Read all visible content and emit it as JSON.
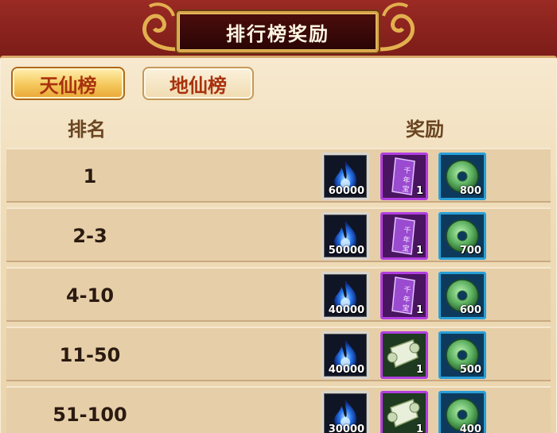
{
  "title": "排行榜奖励",
  "tabs": [
    {
      "label": "天仙榜",
      "active": true
    },
    {
      "label": "地仙榜",
      "active": false
    }
  ],
  "columns": {
    "rank": "排名",
    "reward": "奖励"
  },
  "rows": [
    {
      "rank": "1",
      "rewards": [
        {
          "icon": "blue-flame-icon",
          "count": "60000"
        },
        {
          "icon": "purple-talisman-icon",
          "count": "1"
        },
        {
          "icon": "jade-disc-icon",
          "count": "800"
        }
      ]
    },
    {
      "rank": "2-3",
      "rewards": [
        {
          "icon": "blue-flame-icon",
          "count": "50000"
        },
        {
          "icon": "purple-talisman-icon",
          "count": "1"
        },
        {
          "icon": "jade-disc-icon",
          "count": "700"
        }
      ]
    },
    {
      "rank": "4-10",
      "rewards": [
        {
          "icon": "blue-flame-icon",
          "count": "40000"
        },
        {
          "icon": "purple-talisman-icon",
          "count": "1"
        },
        {
          "icon": "jade-disc-icon",
          "count": "600"
        }
      ]
    },
    {
      "rank": "11-50",
      "rewards": [
        {
          "icon": "blue-flame-icon",
          "count": "40000"
        },
        {
          "icon": "scroll-icon",
          "count": "1"
        },
        {
          "icon": "jade-disc-icon",
          "count": "500"
        }
      ]
    },
    {
      "rank": "51-100",
      "rewards": [
        {
          "icon": "blue-flame-icon",
          "count": "30000"
        },
        {
          "icon": "scroll-icon",
          "count": "1"
        },
        {
          "icon": "jade-disc-icon",
          "count": "400"
        }
      ]
    }
  ],
  "colors": {
    "header": "#8f2420",
    "panel": "#efdcb8",
    "row": "#e6cfa8",
    "tab_active": "#f5c75a",
    "accent_text": "#a8320e"
  }
}
